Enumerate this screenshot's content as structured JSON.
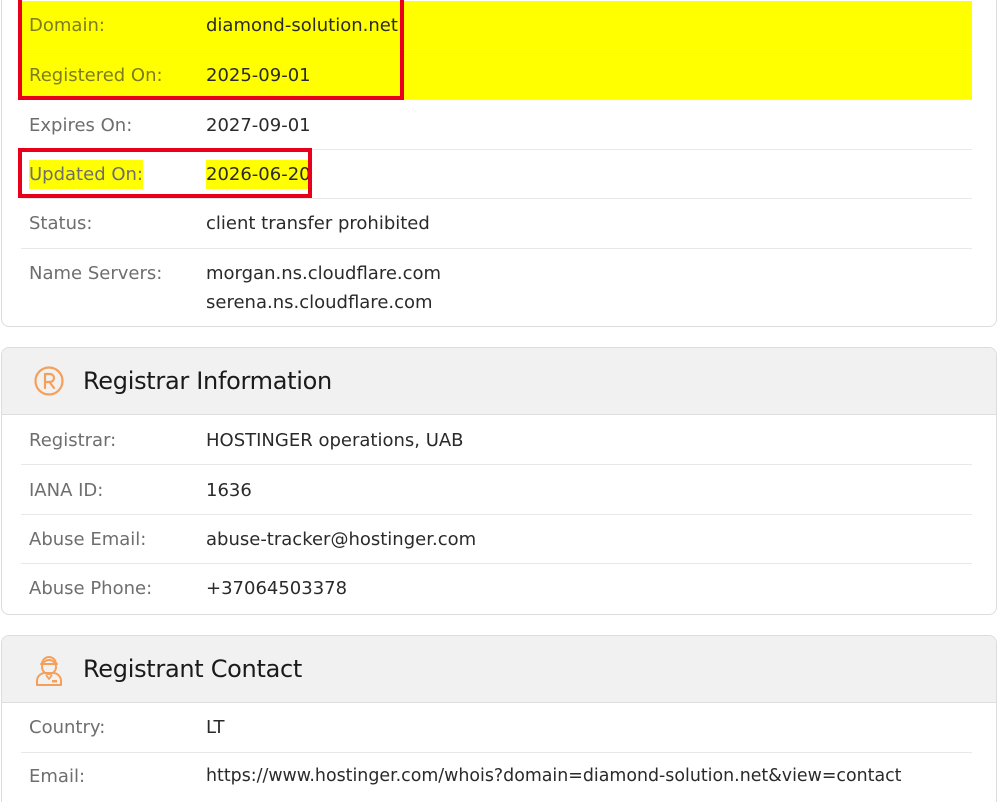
{
  "domain_card": {
    "rows": [
      {
        "label": "Domain:",
        "value": "diamond-solution.net",
        "highlighted": true
      },
      {
        "label": "Registered On:",
        "value": "2025-09-01",
        "highlighted": true
      },
      {
        "label": "Expires On:",
        "value": "2027-09-01",
        "highlighted": false
      },
      {
        "label": "Updated On:",
        "value": "2026-06-20",
        "highlighted": true
      },
      {
        "label": "Status:",
        "value": "client transfer prohibited",
        "highlighted": false
      },
      {
        "label": "Name Servers:",
        "values": [
          "morgan.ns.cloudflare.com",
          "serena.ns.cloudflare.com"
        ],
        "highlighted": false
      }
    ]
  },
  "registrar_card": {
    "title": "Registrar Information",
    "icon": "registered-trademark-icon",
    "rows": [
      {
        "label": "Registrar:",
        "value": "HOSTINGER operations, UAB"
      },
      {
        "label": "IANA ID:",
        "value": "1636"
      },
      {
        "label": "Abuse Email:",
        "value": "abuse-tracker@hostinger.com"
      },
      {
        "label": "Abuse Phone:",
        "value": "+37064503378"
      }
    ]
  },
  "registrant_card": {
    "title": "Registrant Contact",
    "icon": "person-icon",
    "rows": [
      {
        "label": "Country:",
        "value": "LT"
      },
      {
        "label": "Email:",
        "value": "https://www.hostinger.com/whois?domain=diamond-solution.net&view=contact"
      }
    ]
  },
  "colors": {
    "highlight": "#ffff00",
    "annotation_box": "#e8001a",
    "icon_accent": "#f5a05a"
  }
}
